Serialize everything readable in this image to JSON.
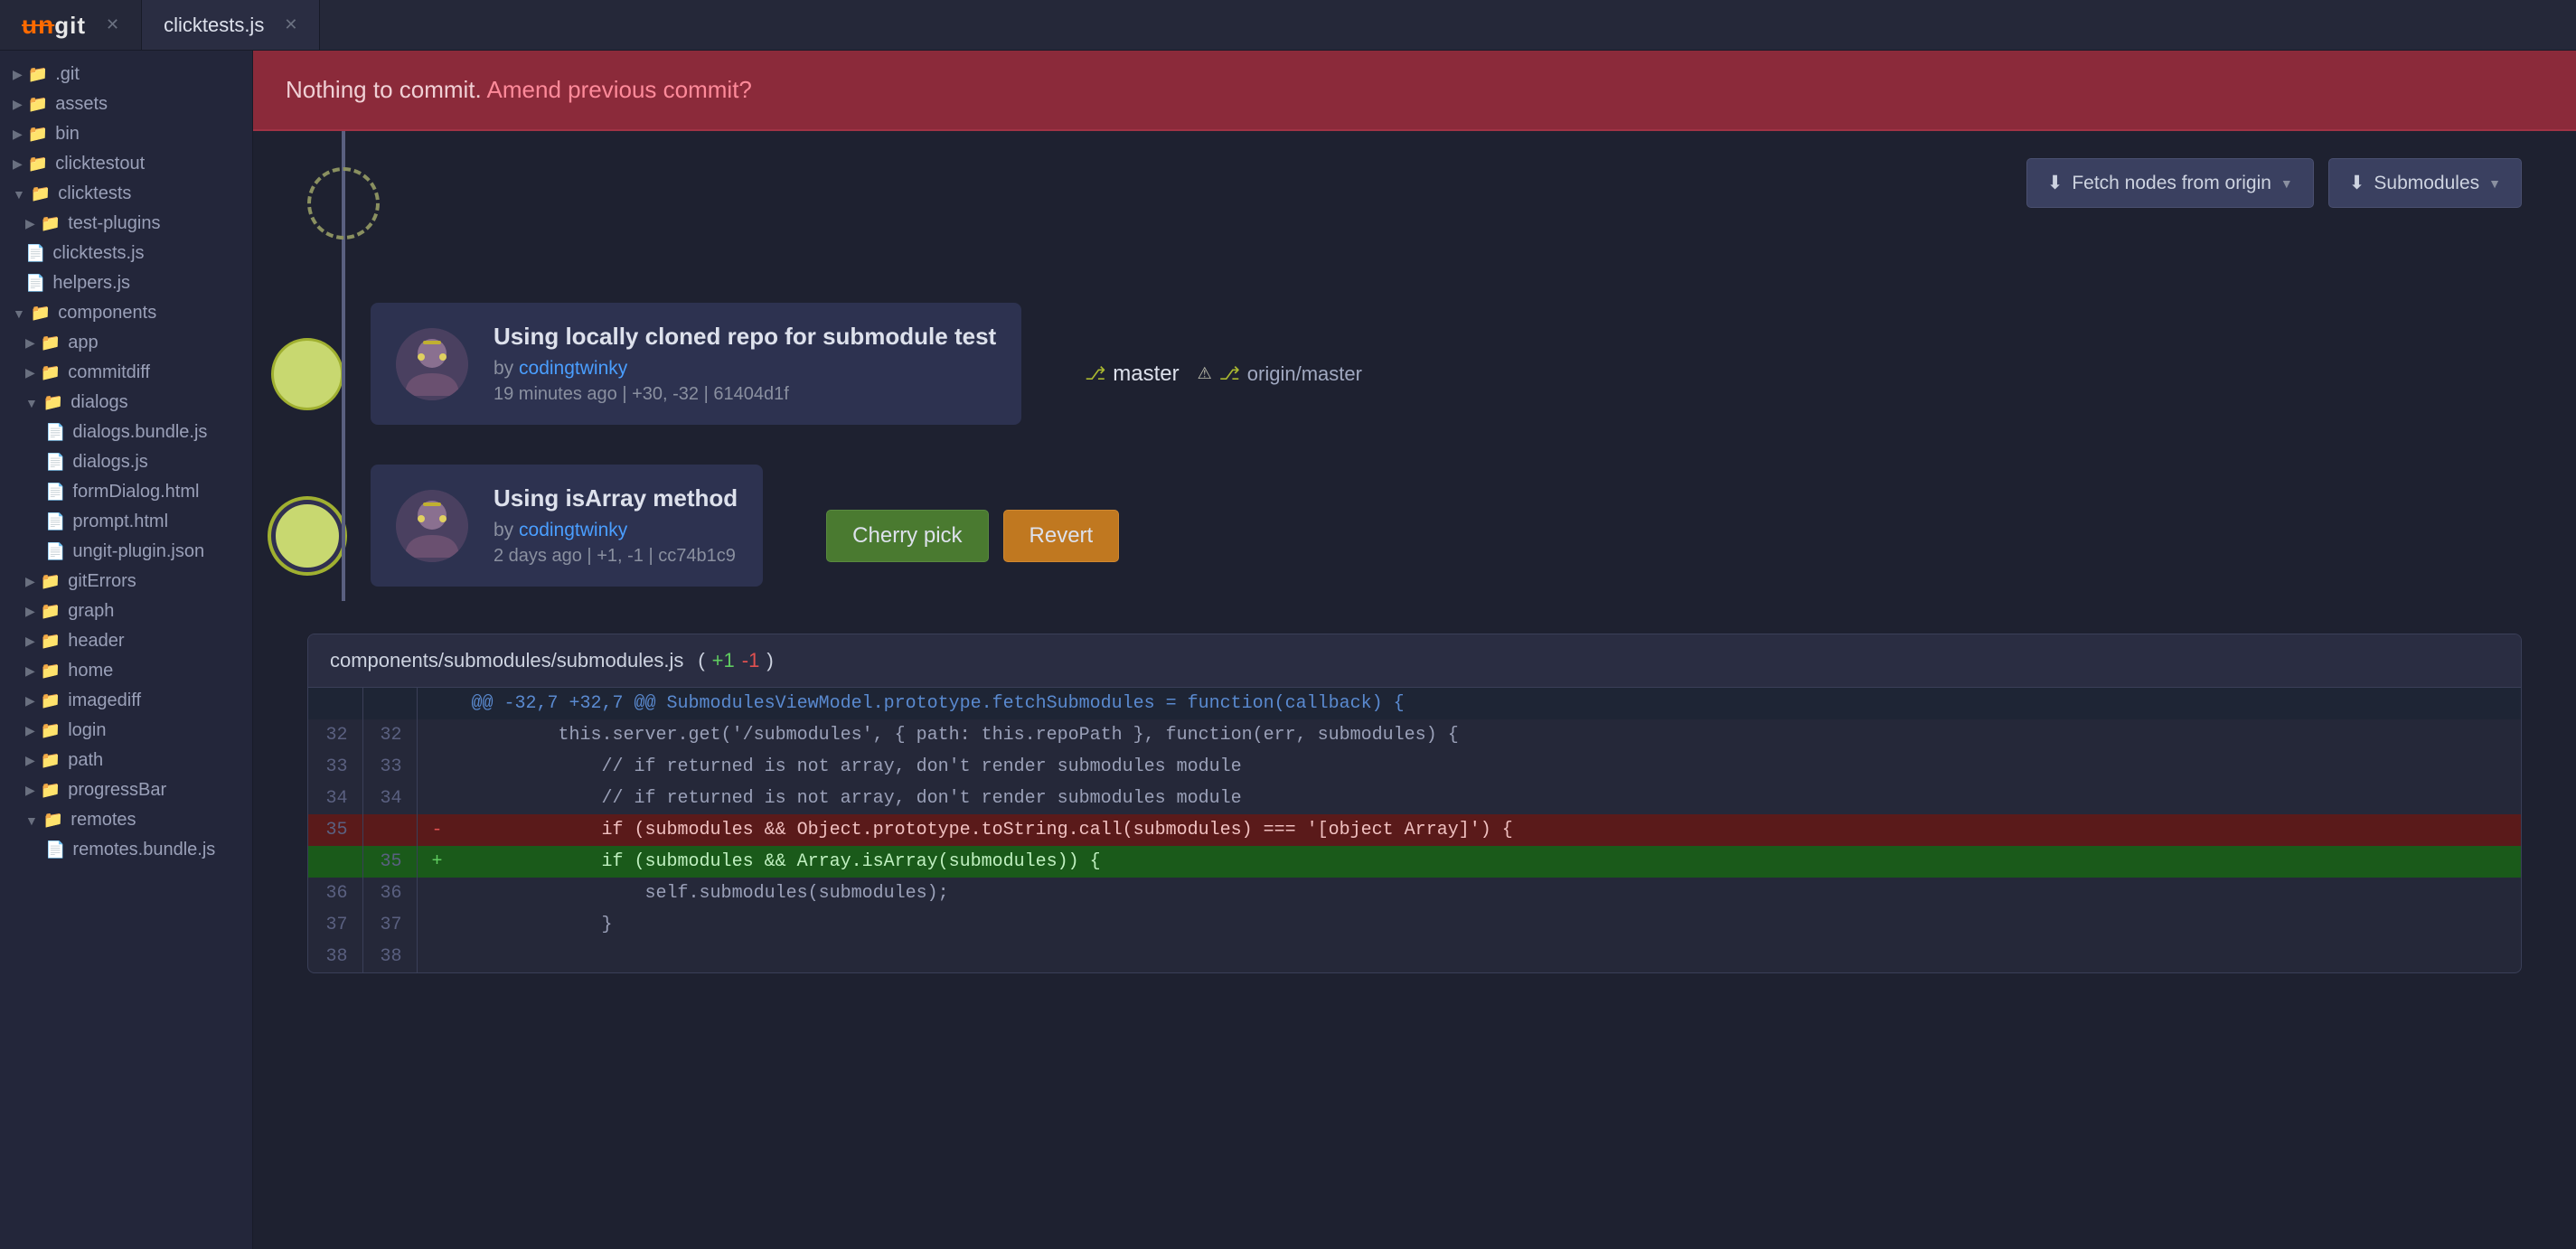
{
  "tabs": [
    {
      "id": "ungit",
      "label": "ungit",
      "logo": true,
      "active": false,
      "closable": true
    },
    {
      "id": "clicktests",
      "label": "clicktests.js",
      "active": true,
      "closable": true
    }
  ],
  "sidebar": {
    "items": [
      {
        "id": "git",
        "label": ".git",
        "type": "folder",
        "indent": 0,
        "expanded": false
      },
      {
        "id": "assets",
        "label": "assets",
        "type": "folder",
        "indent": 0,
        "expanded": false
      },
      {
        "id": "bin",
        "label": "bin",
        "type": "folder",
        "indent": 0,
        "expanded": false
      },
      {
        "id": "clicktestout",
        "label": "clicktestout",
        "type": "folder",
        "indent": 0,
        "expanded": false
      },
      {
        "id": "clicktests",
        "label": "clicktests",
        "type": "folder",
        "indent": 0,
        "expanded": true
      },
      {
        "id": "test-plugins",
        "label": "test-plugins",
        "type": "folder",
        "indent": 1,
        "expanded": false
      },
      {
        "id": "clicktests-js",
        "label": "clicktests.js",
        "type": "file",
        "indent": 1
      },
      {
        "id": "helpers-js",
        "label": "helpers.js",
        "type": "file",
        "indent": 1
      },
      {
        "id": "components",
        "label": "components",
        "type": "folder",
        "indent": 0,
        "expanded": true
      },
      {
        "id": "app",
        "label": "app",
        "type": "folder",
        "indent": 1,
        "expanded": false
      },
      {
        "id": "commitdiff",
        "label": "commitdiff",
        "type": "folder",
        "indent": 1,
        "expanded": false
      },
      {
        "id": "dialogs",
        "label": "dialogs",
        "type": "folder",
        "indent": 1,
        "expanded": true
      },
      {
        "id": "dialogs-bundle-js",
        "label": "dialogs.bundle.js",
        "type": "file",
        "indent": 2
      },
      {
        "id": "dialogs-js",
        "label": "dialogs.js",
        "type": "file",
        "indent": 2
      },
      {
        "id": "formDialog-html",
        "label": "formDialog.html",
        "type": "file",
        "indent": 2
      },
      {
        "id": "prompt-html",
        "label": "prompt.html",
        "type": "file",
        "indent": 2
      },
      {
        "id": "ungit-plugin-json",
        "label": "ungit-plugin.json",
        "type": "file",
        "indent": 2
      },
      {
        "id": "gitErrors",
        "label": "gitErrors",
        "type": "folder",
        "indent": 1,
        "expanded": false
      },
      {
        "id": "graph",
        "label": "graph",
        "type": "folder",
        "indent": 1,
        "expanded": false
      },
      {
        "id": "header",
        "label": "header",
        "type": "folder",
        "indent": 1,
        "expanded": false
      },
      {
        "id": "home",
        "label": "home",
        "type": "folder",
        "indent": 1,
        "expanded": false
      },
      {
        "id": "imagediff",
        "label": "imagediff",
        "type": "folder",
        "indent": 1,
        "expanded": false
      },
      {
        "id": "login",
        "label": "login",
        "type": "folder",
        "indent": 1,
        "expanded": false
      },
      {
        "id": "path",
        "label": "path",
        "type": "folder",
        "indent": 1,
        "expanded": false
      },
      {
        "id": "progressBar",
        "label": "progressBar",
        "type": "folder",
        "indent": 1,
        "expanded": false
      },
      {
        "id": "remotes",
        "label": "remotes",
        "type": "folder",
        "indent": 1,
        "expanded": true
      },
      {
        "id": "remotes-bundle-js",
        "label": "remotes.bundle.js",
        "type": "file",
        "indent": 2
      }
    ]
  },
  "commit_banner": {
    "static_text": "Nothing to commit. ",
    "link_text": "Amend previous commit?"
  },
  "graph": {
    "fetch_button": "Fetch nodes from origin",
    "submodules_button": "Submodules",
    "commits": [
      {
        "id": "commit-1",
        "title": "Using locally cloned repo for submodule test",
        "author": "codingtwinky",
        "time_ago": "19 minutes ago",
        "stats": "+30, -32",
        "hash": "61404d1f",
        "node_type": "solid",
        "branch_label": "master",
        "origin_label": "origin/master",
        "actions": []
      },
      {
        "id": "commit-2",
        "title": "Using isArray method",
        "author": "codingtwinky",
        "time_ago": "2 days ago",
        "stats": "+1, -1",
        "hash": "cc74b1c9",
        "node_type": "ring",
        "actions": [
          "Cherry pick",
          "Revert"
        ]
      }
    ]
  },
  "diff": {
    "file_path": "components/submodules/submodules.js",
    "added": "+1",
    "removed": "-1",
    "meta_line": "@@ -32,7 +32,7 @@ SubmodulesViewModel.prototype.fetchSubmodules = function(callback) {",
    "lines": [
      {
        "num_left": "32",
        "num_right": "32",
        "sign": "",
        "content": "        this.server.get('/submodules', { path: this.repoPath }, function(err, submodules) {",
        "type": "normal"
      },
      {
        "num_left": "33",
        "num_right": "33",
        "sign": "",
        "content": "            // if returned is not array, don't render submodules module",
        "type": "normal"
      },
      {
        "num_left": "34",
        "num_right": "34",
        "sign": "",
        "content": "            // if returned is not array, don't render submodules module",
        "type": "normal_hidden"
      },
      {
        "num_left": "35",
        "num_right": "",
        "sign": "-",
        "content": "            if (submodules && Object.prototype.toString.call(submodules) === '[object Array]') {",
        "type": "removed"
      },
      {
        "num_left": "",
        "num_right": "35",
        "sign": "+",
        "content": "            if (submodules && Array.isArray(submodules)) {",
        "type": "added"
      },
      {
        "num_left": "36",
        "num_right": "36",
        "sign": "",
        "content": "                self.submodules(submodules);",
        "type": "normal"
      },
      {
        "num_left": "37",
        "num_right": "37",
        "sign": "",
        "content": "            }",
        "type": "normal"
      },
      {
        "num_left": "38",
        "num_right": "38",
        "sign": "",
        "content": "",
        "type": "normal"
      }
    ]
  }
}
